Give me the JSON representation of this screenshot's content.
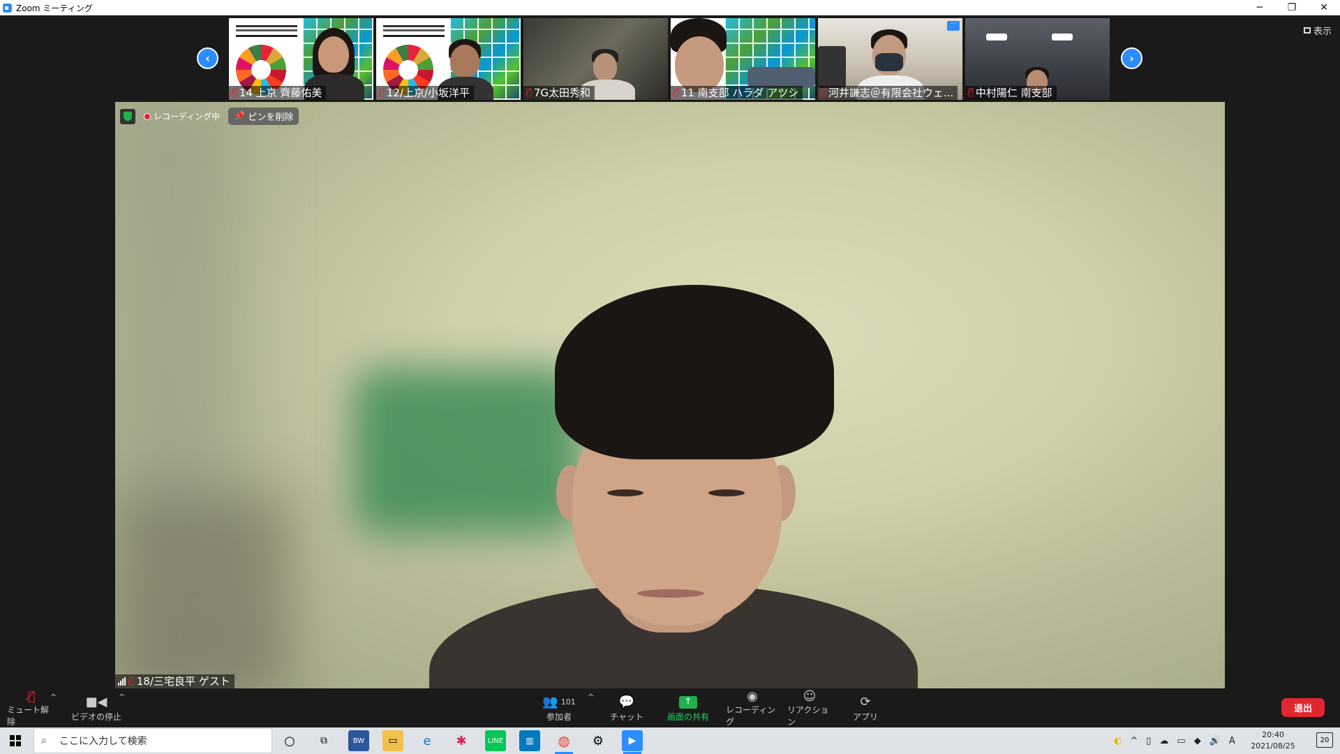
{
  "window": {
    "title": "Zoom ミーティング",
    "controls": [
      "─",
      "❐",
      "✕"
    ]
  },
  "strip": {
    "view_label": "表示",
    "prev_arrow": "‹",
    "next_arrow": "›",
    "thumbnails": [
      {
        "name": "14 上京 齊藤佑美",
        "muted": true
      },
      {
        "name": "12/上京/小坂洋平",
        "muted": true
      },
      {
        "name": "7G太田秀和",
        "muted": true
      },
      {
        "name": "11 南支部 ハラダ アツシ",
        "muted": true
      },
      {
        "name": "河井謙志＠有限会社ウェ...",
        "muted": true,
        "more": "···"
      },
      {
        "name": "中村陽仁 南支部",
        "muted": true
      }
    ]
  },
  "main": {
    "recording_label": "レコーディング中",
    "unpin_label": "ピンを削除",
    "speaker_name": "18/三宅良平 ゲスト"
  },
  "toolbar": {
    "mute_label": "ミュート解除",
    "video_label": "ビデオの停止",
    "participants_count": "101",
    "participants_label": "参加者",
    "chat_label": "チャット",
    "share_label": "画面の共有",
    "record_label": "レコーディング",
    "reactions_label": "リアクション",
    "apps_label": "アプリ",
    "end_label": "退出"
  },
  "taskbar": {
    "search_placeholder": "ここに入力して検索",
    "ime_indicator": "A",
    "time": "20:40",
    "date": "2021/08/25",
    "notification_count": "20"
  },
  "colors": {
    "accent": "#2d8cff",
    "share_green": "#23b14d",
    "end_red": "#e0262f",
    "muted_red": "#e0262f"
  }
}
